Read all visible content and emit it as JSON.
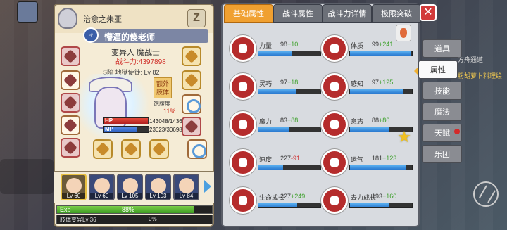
{
  "character": {
    "owner": "治愈之朱亚",
    "name": "懵逼的傻老师",
    "gender_symbol": "♂",
    "class_line": "变异人 魔战士",
    "power": "战斗力:4397898",
    "level_line": "S阶 地狱使徒: Lv 82",
    "extra_tag": "额外肢体",
    "satiety_label": "饱腹度",
    "satiety_value": "11%",
    "hp_label": "HP",
    "hp_value": "143048/1436",
    "hp_fraction": 0.99,
    "mp_label": "MP",
    "mp_value": "23023/30698",
    "mp_fraction": 0.75,
    "rank_icon": "Z"
  },
  "party": {
    "members": [
      {
        "level": "Lv 60",
        "selected": true
      },
      {
        "level": "Lv 60",
        "selected": false
      },
      {
        "level": "Lv 105",
        "selected": false
      },
      {
        "level": "Lv 103",
        "selected": false
      },
      {
        "level": "Lv 84",
        "selected": false
      }
    ]
  },
  "exp": {
    "label": "Exp",
    "percent": "88%",
    "fraction": 0.88,
    "sub_label": "肢体变异Lv 36",
    "sub_percent": "0%"
  },
  "tabs": [
    "基础属性",
    "战斗属性",
    "战斗力详情",
    "极限突破"
  ],
  "active_tab": 0,
  "stats": [
    {
      "name": "力量",
      "base": "98",
      "bonus": "+10",
      "neg": false,
      "fraction": 0.55
    },
    {
      "name": "体质",
      "base": "99",
      "bonus": "+241",
      "neg": false,
      "fraction": 0.98
    },
    {
      "name": "灵巧",
      "base": "97",
      "bonus": "+18",
      "neg": false,
      "fraction": 0.6
    },
    {
      "name": "感知",
      "base": "97",
      "bonus": "+125",
      "neg": false,
      "fraction": 0.85
    },
    {
      "name": "魔力",
      "base": "83",
      "bonus": "+88",
      "neg": false,
      "fraction": 0.5
    },
    {
      "name": "意志",
      "base": "88",
      "bonus": "+86",
      "neg": false,
      "fraction": 0.62
    },
    {
      "name": "速度",
      "base": "227",
      "bonus": "-91",
      "neg": true,
      "fraction": 0.4
    },
    {
      "name": "运气",
      "base": "181",
      "bonus": "+123",
      "neg": false,
      "fraction": 0.9
    },
    {
      "name": "生命成长",
      "base": "227",
      "bonus": "+249",
      "neg": false,
      "fraction": 0.62
    },
    {
      "name": "去力成长",
      "base": "193",
      "bonus": "+160",
      "neg": false,
      "fraction": 0.62
    }
  ],
  "side_tabs": [
    "道具",
    "属性",
    "技能",
    "魔法",
    "天赋",
    "乐团"
  ],
  "active_side_tab": 1,
  "right_text": {
    "deco1": "方舟通道",
    "deco2": "粉胡萝卜料理绘"
  },
  "icons": {
    "close": "close-icon",
    "star": "star-icon",
    "potion": "potion-icon"
  }
}
